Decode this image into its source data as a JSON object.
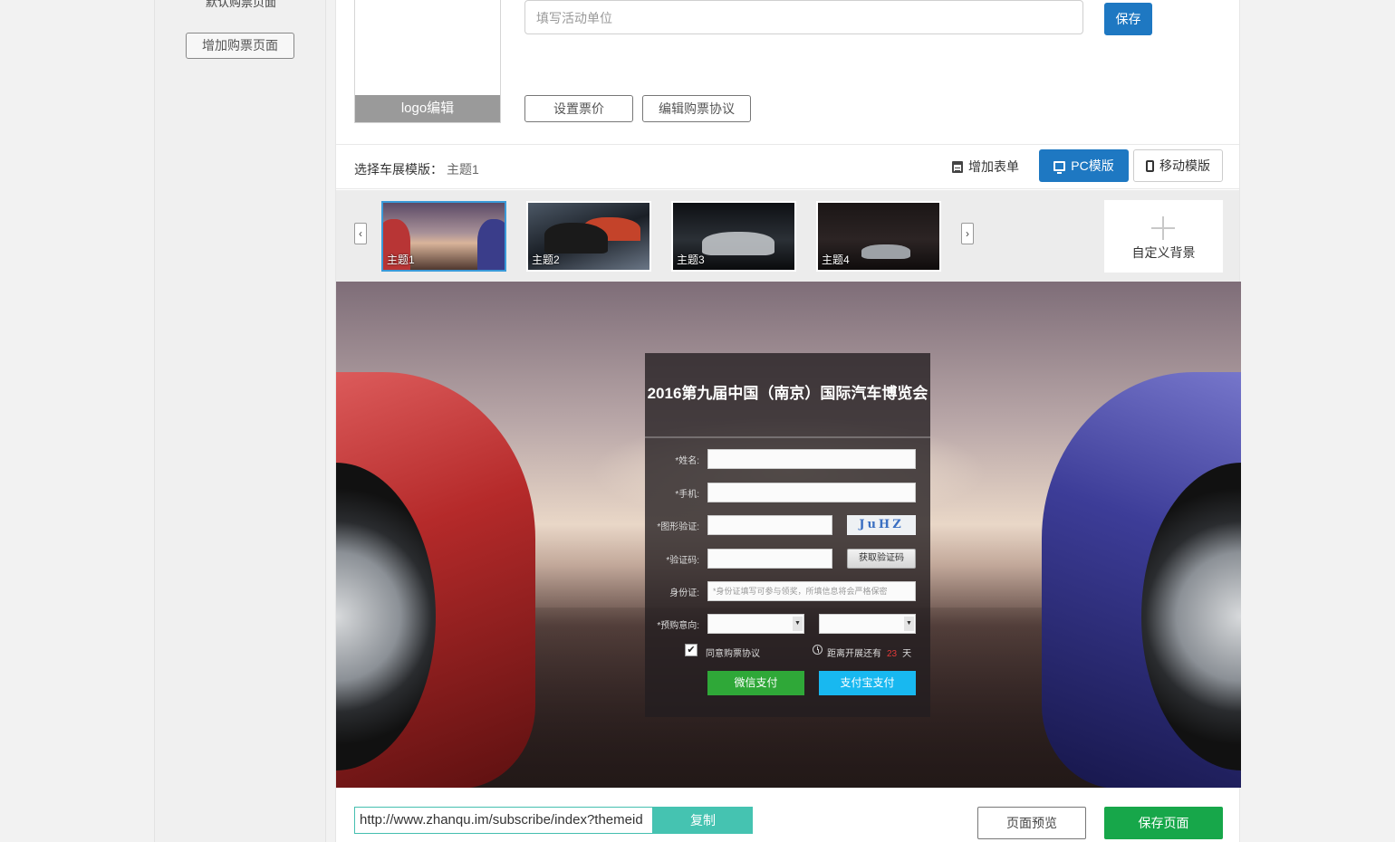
{
  "sidebar": {
    "default_page": "默认购票页面",
    "add_page_button": "增加购票页面"
  },
  "header": {
    "logo_edit": "logo编辑",
    "org_input_placeholder": "填写活动单位",
    "save_label": "保存",
    "set_price_label": "设置票价",
    "edit_agreement_label": "编辑购票协议"
  },
  "template_bar": {
    "label": "选择车展模版：",
    "current": "主题1",
    "add_form_label": "增加表单",
    "pc_template_label": "PC模版",
    "mobile_template_label": "移动模版",
    "active_template": "pc"
  },
  "themes": {
    "prev_arrow": "‹",
    "next_arrow": "›",
    "items": [
      {
        "label": "主题1",
        "selected": true
      },
      {
        "label": "主题2",
        "selected": false
      },
      {
        "label": "主题3",
        "selected": false
      },
      {
        "label": "主题4",
        "selected": false
      }
    ],
    "selected_check": "✔",
    "custom_background_label": "自定义背景"
  },
  "preview_form": {
    "title": "2016第九届中国（南京）国际汽车博览会",
    "name_label": "*姓名:",
    "phone_label": "*手机:",
    "captcha_label": "*图形验证:",
    "captcha_text": "JuHZ",
    "code_label": "*验证码:",
    "get_code_button": "获取验证码",
    "id_label": "身份证:",
    "id_placeholder": "*身份证填写可参与领奖，所填信息将会严格保密",
    "intent_label": "*预购意向:",
    "select_arrow": "▼",
    "agree_checked": true,
    "agree_checkmark": "✔",
    "agree_text": "同意购票协议",
    "countdown_prefix": "距离开展还有",
    "countdown_days": "23",
    "countdown_suffix": "天",
    "wechat_pay_label": "微信支付",
    "alipay_label": "支付宝支付"
  },
  "bottom_bar": {
    "url": "http://www.zhanqu.im/subscribe/index?themeid",
    "copy_label": "复制",
    "preview_label": "页面预览",
    "save_page_label": "保存页面"
  },
  "colors": {
    "primary_blue": "#1e78c2",
    "copy_teal": "#45c3b1",
    "save_green": "#17a74a",
    "wechat_green": "#2fa838",
    "alipay_blue": "#18b8f0",
    "countdown_red": "#e23a3a"
  }
}
